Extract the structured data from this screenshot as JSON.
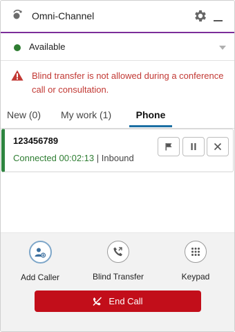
{
  "header": {
    "title": "Omni-Channel",
    "icons": [
      "omni-channel-logo-icon",
      "gear-icon",
      "minimize-icon"
    ]
  },
  "status": {
    "label": "Available",
    "dot_color": "#2e7d32"
  },
  "error": {
    "message": "Blind transfer is not allowed during a conference call or consultation.",
    "color": "#c23934"
  },
  "tabs": [
    {
      "label": "New (0)",
      "active": false
    },
    {
      "label": "My work (1)",
      "active": false
    },
    {
      "label": "Phone",
      "active": true
    }
  ],
  "call": {
    "number": "123456789",
    "status": "Connected",
    "duration": "00:02:13",
    "separator": "|",
    "direction": "Inbound",
    "accent_color": "#2e8540",
    "controls": [
      "flag-icon",
      "pause-icon",
      "close-icon"
    ]
  },
  "actions": [
    {
      "label": "Add Caller",
      "icon": "add-caller-icon"
    },
    {
      "label": "Blind Transfer",
      "icon": "blind-transfer-icon"
    },
    {
      "label": "Keypad",
      "icon": "keypad-icon"
    }
  ],
  "end_call": {
    "label": "End Call",
    "color": "#c20e1a",
    "icon": "end-call-icon"
  }
}
